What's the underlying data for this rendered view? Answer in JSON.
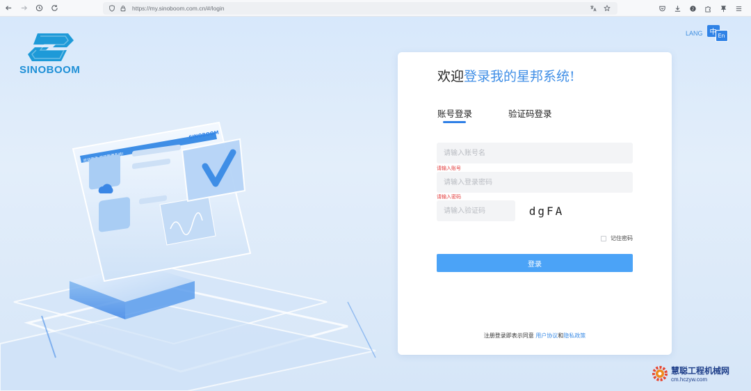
{
  "browser": {
    "url": "https://my.sinoboom.com.cn/#/login",
    "icons": [
      "back-icon",
      "forward-icon",
      "history-icon",
      "reload-icon",
      "shield-icon",
      "lock-icon",
      "translate-icon",
      "bookmark-star-icon",
      "pocket-icon",
      "download-icon",
      "account-icon",
      "extensions-icon",
      "pin-icon",
      "menu-icon"
    ]
  },
  "brand": {
    "logo_text": "SINOBOOM",
    "color": "#1e8fd6"
  },
  "lang": {
    "label": "LANG",
    "zh": "中",
    "en": "En"
  },
  "illustration": {
    "panel_brand": "SINOBOOM",
    "panel_banner": "欢迎登录 星邦管理系统!"
  },
  "login": {
    "welcome_prefix": "欢迎",
    "welcome_highlight": "登录我的星邦系统!",
    "tabs": [
      {
        "label": "账号登录",
        "active": true
      },
      {
        "label": "验证码登录",
        "active": false
      }
    ],
    "username_placeholder": "请输入账号名",
    "username_error": "请输入账号",
    "password_placeholder": "请输入登录密码",
    "password_error": "请输入密码",
    "captcha_placeholder": "请输入验证码",
    "captcha_text": "dgFA",
    "remember_label": "记住密码",
    "login_button": "登录",
    "agreement_prefix": "注册登录即表示同意",
    "user_agreement": "用户协议",
    "and": "和",
    "privacy_policy": "隐私政策",
    "accent_color": "#4ba3f7",
    "error_color": "#e23b3b"
  },
  "watermark": {
    "title": "慧聪工程机械网",
    "url": "cm.hczyw.com"
  }
}
